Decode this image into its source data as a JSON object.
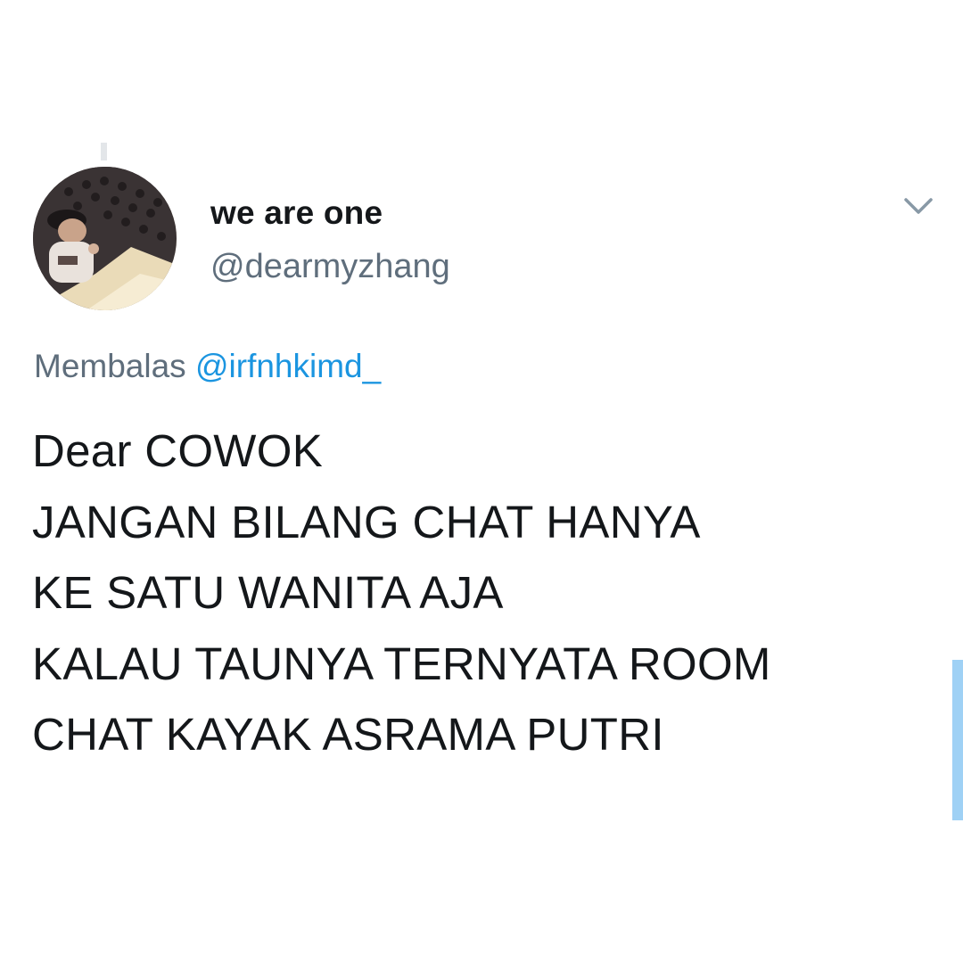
{
  "tweet": {
    "display_name": "we are one",
    "handle": "@dearmyzhang",
    "reply": {
      "prefix": "Membalas",
      "mention": "@irfnhkimd_"
    },
    "text_lines": [
      "Dear COWOK",
      "JANGAN BILANG CHAT HANYA",
      "KE SATU WANITA AJA",
      "KALAU TAUNYA TERNYATA ROOM",
      "CHAT KAYAK ASRAMA PUTRI"
    ],
    "avatar_icon": "profile-photo",
    "menu_icon": "chevron-down-icon"
  },
  "colors": {
    "background": "#ffffff",
    "name": "#14171a",
    "handle": "#5f6e7c",
    "mention": "#1b95e0",
    "scroll_indicator": "#9fd1f5"
  }
}
